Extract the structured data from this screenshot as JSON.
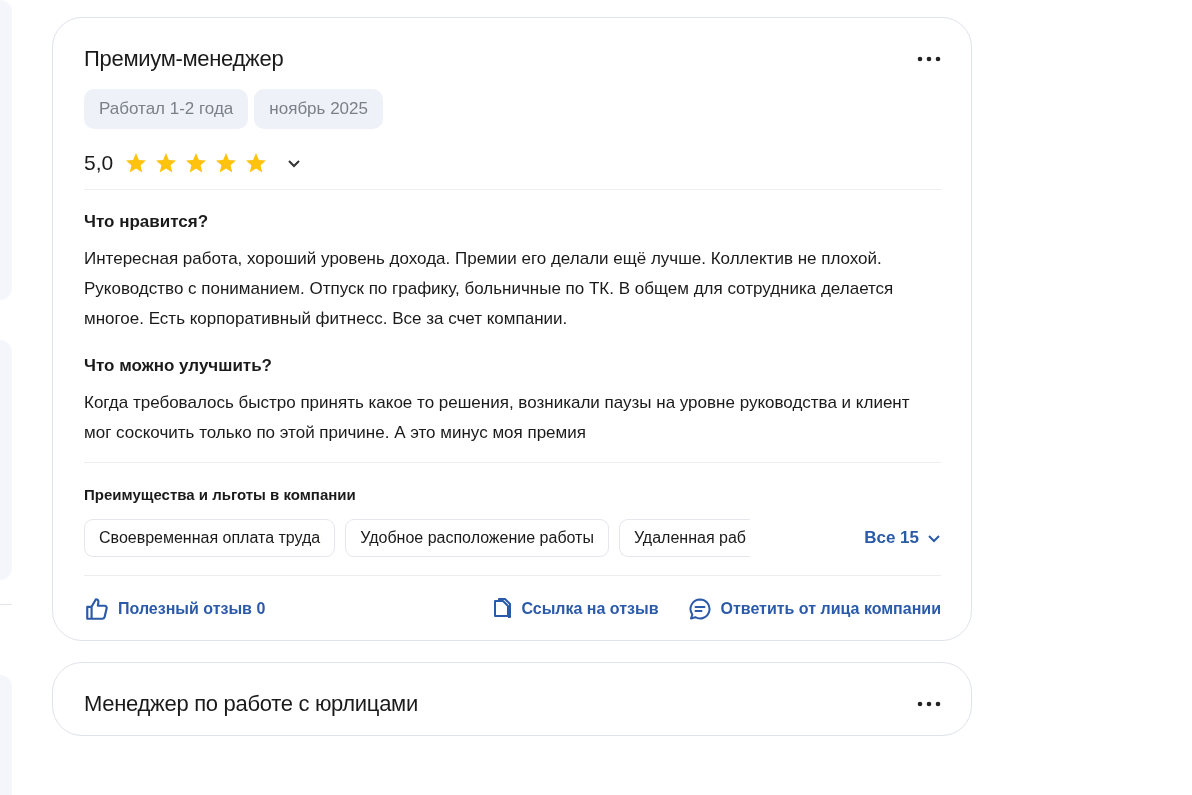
{
  "reviews": [
    {
      "title": "Премиум-менеджер",
      "tags": [
        "Работал 1-2 года",
        "ноябрь 2025"
      ],
      "rating": "5,0",
      "stars": 5,
      "sections": [
        {
          "heading": "Что нравится?",
          "text": "Интересная работа, хороший уровень дохода. Премии его делали ещё лучше. Коллектив не плохой. Руководство с пониманием. Отпуск по графику, больничные по ТК. В общем для сотрудника делается многое. Есть корпоративный фитнесс. Все за счет компании."
        },
        {
          "heading": "Что можно улучшить?",
          "text": "Когда требовалось быстро принять какое то решения, возникали паузы на уровне руководства и клиент мог соскочить только по этой причине. А это минус моя премия"
        }
      ],
      "benefits_title": "Преимущества и льготы в компании",
      "benefits": [
        "Своевременная оплата труда",
        "Удобное расположение работы",
        "Удаленная раб"
      ],
      "benefits_more": "Все 15",
      "actions": [
        {
          "kind": "like",
          "label": "Полезный отзыв 0"
        },
        {
          "kind": "link",
          "label": "Ссылка на отзыв"
        },
        {
          "kind": "reply",
          "label": "Ответить от лица компании"
        }
      ]
    },
    {
      "title": "Менеджер по работе с юрлицами"
    }
  ]
}
